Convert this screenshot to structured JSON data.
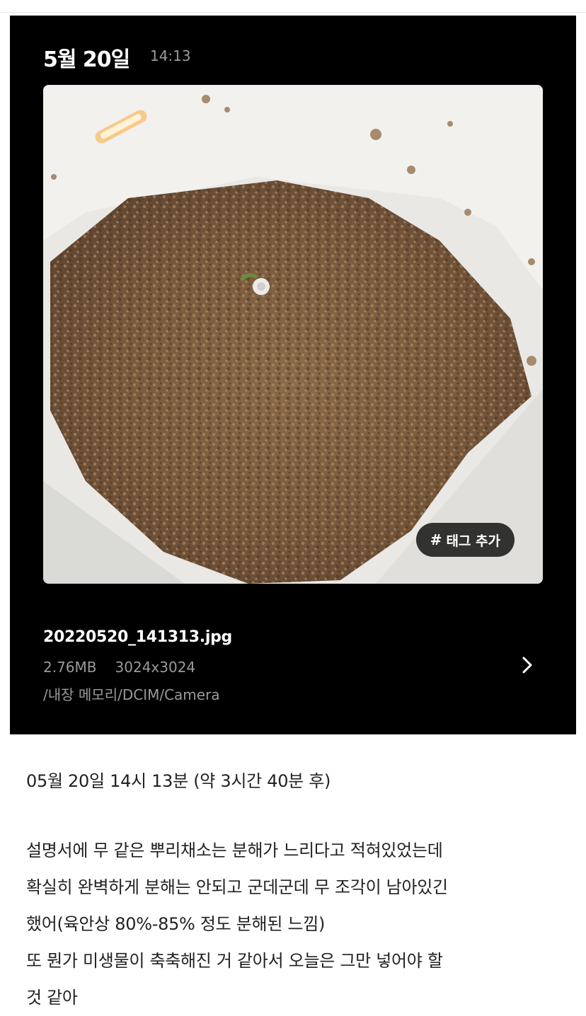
{
  "card": {
    "date": "5월 20일",
    "time": "14:13",
    "tag_button_label": "태그 추가",
    "tag_icon": "hash-icon",
    "file_name": "20220520_141313.jpg",
    "file_size": "2.76MB",
    "resolution": "3024x3024",
    "path": "/내장 메모리/DCIM/Camera",
    "chevron_icon": "chevron-right-icon"
  },
  "post": {
    "caption": "05월 20일 14시 13분 (약 3시간 40분 후)",
    "lines": [
      "설명서에 무 같은 뿌리채소는 분해가 느리다고 적혀있었는데",
      "확실히 완벽하게 분해는 안되고 군데군데 무 조각이 남아있긴",
      "했어(육안상 80%-85% 정도 분해된 느낌)",
      "또 뭔가 미생물이 축축해진 거 같아서 오늘은 그만 넣어야 할",
      "것 같아"
    ]
  }
}
